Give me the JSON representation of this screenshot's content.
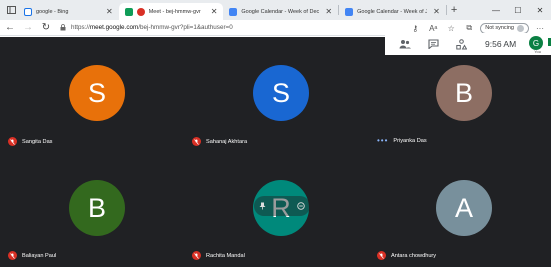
{
  "browser": {
    "tabs": [
      {
        "label": "google - Bing",
        "fav_color": "#1a73e8",
        "active": false
      },
      {
        "label": "Meet - bej-hmmw-gvr",
        "fav_color": "#d93025",
        "active": true
      },
      {
        "label": "Google Calendar - Week of Dec",
        "fav_color": "#4285f4",
        "active": false
      },
      {
        "label": "Google Calendar - Week of Jan",
        "fav_color": "#4285f4",
        "active": false
      }
    ],
    "address": {
      "prefix": "https://",
      "host": "meet.google.com",
      "path": "/bej-hmmw-gvr?pli=1&authuser=0"
    },
    "sync_label": "Not syncing"
  },
  "meet": {
    "time": "9:56 AM",
    "you_initial": "G",
    "you_label": "You"
  },
  "participants": [
    {
      "initial": "S",
      "name": "Sangita Das",
      "color": "#e8710a",
      "status": "muted"
    },
    {
      "initial": "S",
      "name": "Sahanaj Akhtara",
      "color": "#1967d2",
      "status": "muted"
    },
    {
      "initial": "B",
      "name": "Priyanka Das",
      "color": "#8d6e63",
      "status": "speaking"
    },
    {
      "initial": "B",
      "name": "Baliayan Paul",
      "color": "#33691e",
      "status": "muted"
    },
    {
      "initial": "R",
      "name": "Rachita Mandal",
      "color": "#00897b",
      "status": "muted"
    },
    {
      "initial": "A",
      "name": "Antara chowdhury",
      "color": "#78909c",
      "status": "muted"
    }
  ],
  "colors": {
    "stage_bg": "#202124",
    "mute_red": "#d93025"
  }
}
